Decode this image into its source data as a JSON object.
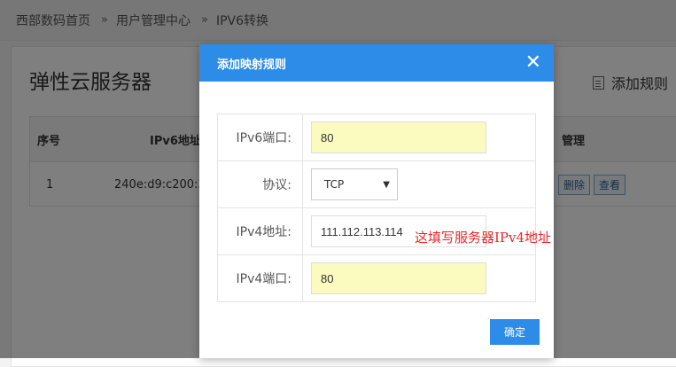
{
  "breadcrumb": {
    "items": [
      "西部数码首页",
      "用户管理中心",
      "IPV6转换"
    ],
    "separator": "»"
  },
  "page": {
    "title": "弹性云服务器",
    "add_rule_label": "添加规则"
  },
  "table": {
    "headers": {
      "index": "序号",
      "ipv6_address": "IPv6地址",
      "manage": "管理"
    },
    "rows": [
      {
        "index": "1",
        "ipv6_address": "240e:d9:c200:3",
        "actions": [
          "删除",
          "查看"
        ]
      }
    ]
  },
  "dialog": {
    "title": "添加映射规则",
    "fields": {
      "ipv6_port": {
        "label": "IPv6端口:",
        "value": "80"
      },
      "protocol": {
        "label": "协议:",
        "value": "TCP"
      },
      "ipv4_address": {
        "label": "IPv4地址:",
        "value": "111.112.113.114"
      },
      "ipv4_port": {
        "label": "IPv4端口:",
        "value": "80"
      }
    },
    "annotation": "这填写服务器IPv4地址",
    "confirm_label": "确定"
  },
  "colors": {
    "accent": "#2d8ce8",
    "highlight_input": "#fbfbc0",
    "annotation": "#e8282b"
  }
}
